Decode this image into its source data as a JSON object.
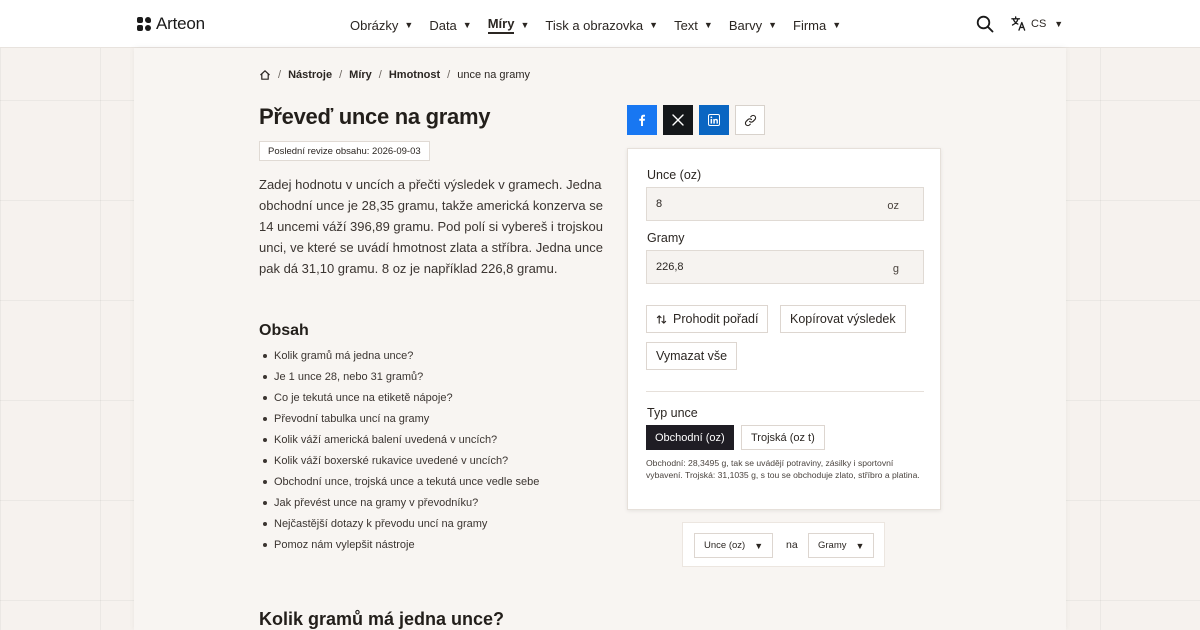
{
  "brand": {
    "name": "Arteon"
  },
  "nav": {
    "items": [
      {
        "label": "Obrázky"
      },
      {
        "label": "Data"
      },
      {
        "label": "Míry"
      },
      {
        "label": "Tisk a obrazovka"
      },
      {
        "label": "Text"
      },
      {
        "label": "Barvy"
      },
      {
        "label": "Firma"
      }
    ],
    "active_item": "Míry",
    "language": "CS"
  },
  "breadcrumb": {
    "items": [
      "Nástroje",
      "Míry",
      "Hmotnost"
    ],
    "current": "unce na gramy"
  },
  "page": {
    "title": "Převeď unce na gramy",
    "revision": "Poslední revize obsahu: 2026-09-03",
    "intro": "Zadej hodnotu v uncích a přečti výsledek v gramech. Jedna obchodní unce je 28,35 gramu, takže americká konzerva se 14 uncemi váží 396,89 gramu. Pod polí si vybereš i trojskou unci, ve které se uvádí hmotnost zlata a stříbra. Jedna unce pak dá 31,10 gramu. 8 oz je například 226,8 gramu.",
    "toc_title": "Obsah",
    "toc": [
      "Kolik gramů má jedna unce?",
      "Je 1 unce 28, nebo 31 gramů?",
      "Co je tekutá unce na etiketě nápoje?",
      "Převodní tabulka uncí na gramy",
      "Kolik váží americká balení uvedená v uncích?",
      "Kolik váží boxerské rukavice uvedené v uncích?",
      "Obchodní unce, trojská unce a tekutá unce vedle sebe",
      "Jak převést unce na gramy v převodníku?",
      "Nejčastější dotazy k převodu uncí na gramy",
      "Pomoz nám vylepšit nástroje"
    ],
    "section_title": "Kolik gramů má jedna unce?"
  },
  "converter": {
    "from_label": "Unce (oz)",
    "from_value": "8",
    "from_unit": "oz",
    "to_label": "Gramy",
    "to_value": "226,8",
    "to_unit": "g",
    "swap_label": "Prohodit pořadí",
    "copy_label": "Kopírovat výsledek",
    "clear_label": "Vymazat vše",
    "type_label": "Typ unce",
    "type_options": [
      "Obchodní (oz)",
      "Trojská (oz t)"
    ],
    "type_selected": "Obchodní (oz)",
    "note": "Obchodní: 28,3495 g, tak se uvádějí potraviny, zásilky i sportovní vybavení. Trojská: 31,1035 g, s tou se obchoduje zlato, stříbro a platina."
  },
  "unit_selector": {
    "from": "Unce (oz)",
    "connector": "na",
    "to": "Gramy"
  },
  "colors": {
    "facebook": "#1877f2",
    "x": "#14171a",
    "linkedin": "#0a66c2",
    "selected_segment": "#1f1d24"
  },
  "icons": [
    "home-icon",
    "facebook-icon",
    "x-icon",
    "linkedin-icon",
    "link-icon",
    "swap-icon",
    "search-icon",
    "translate-icon"
  ]
}
